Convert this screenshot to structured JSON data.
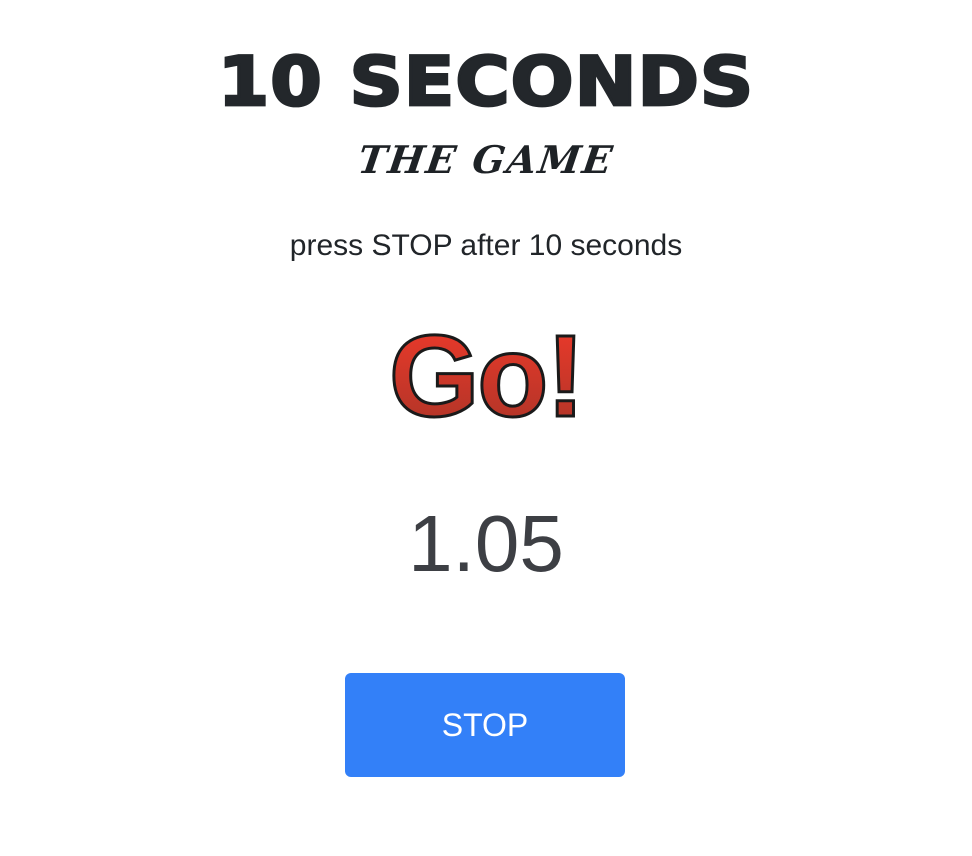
{
  "game": {
    "title": "10 SECONDS",
    "subtitle": "THE GAME",
    "instruction": "press STOP after 10 seconds",
    "status": "Go!",
    "timer": "1.05",
    "stop_label": "STOP"
  },
  "colors": {
    "status_top": "#f23a2a",
    "status_bottom": "#a93428",
    "status_outline": "#1a1a1a",
    "button": "#3380f8",
    "text": "#212529"
  }
}
